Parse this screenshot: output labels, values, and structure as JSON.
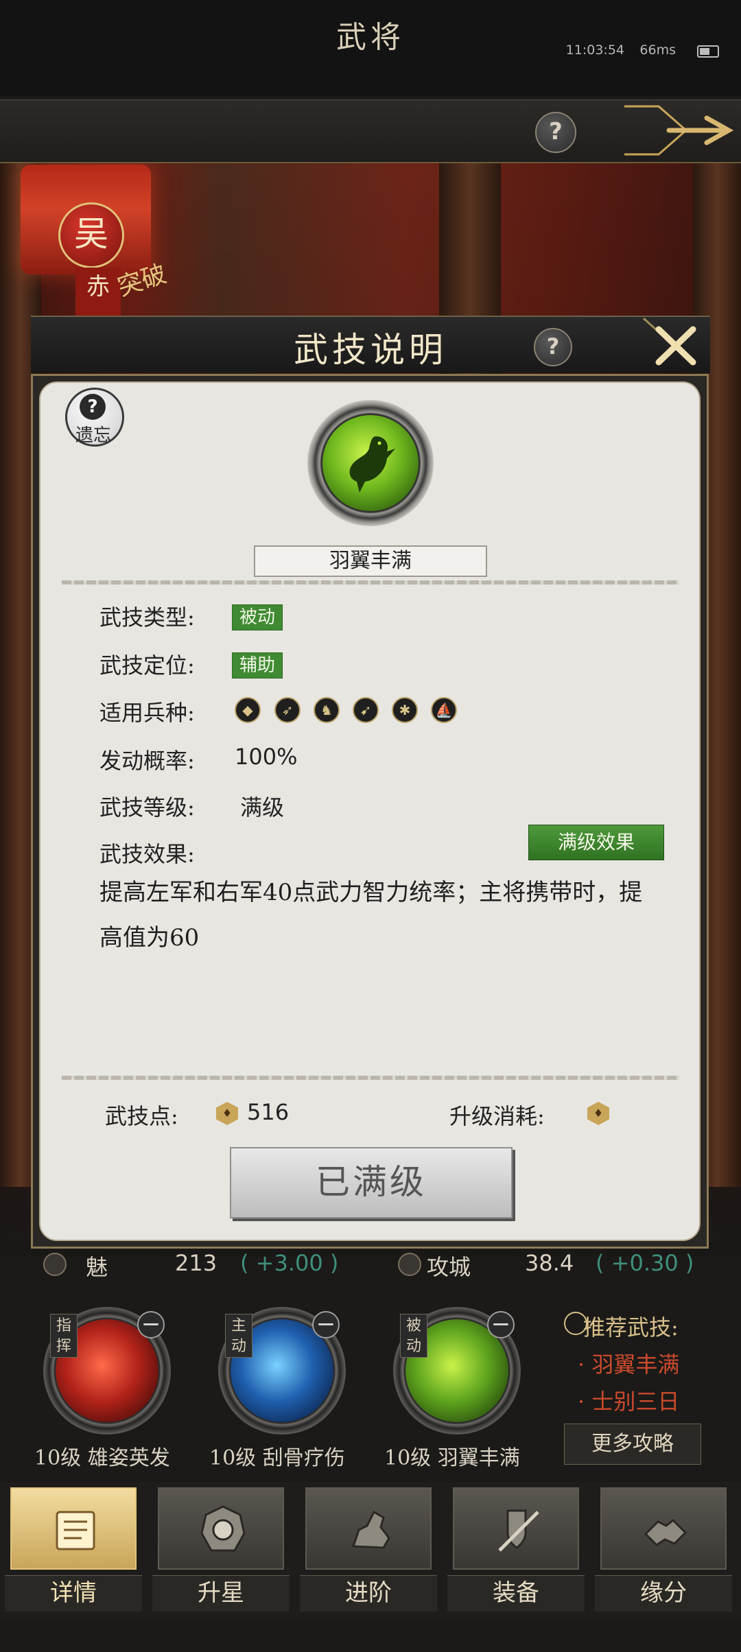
{
  "status_bar": {
    "time": "11:03:54",
    "ping": "66ms"
  },
  "title_bar": {
    "title": "武将"
  },
  "hero": {
    "faction": "吴",
    "tag": "赤",
    "breakthrough": "突破"
  },
  "dialog": {
    "title": "武技说明",
    "forget_label": "遗忘",
    "skill_name": "羽翼丰满",
    "rows": {
      "type_label": "武技类型:",
      "type_value": "被动",
      "role_label": "武技定位:",
      "role_value": "辅助",
      "units_label": "适用兵种:",
      "rate_label": "发动概率:",
      "rate_value": "100%",
      "level_label": "武技等级:",
      "level_value": "满级",
      "effect_label": "武技效果:"
    },
    "max_effect_button": "满级效果",
    "effect_text": "提高左军和右军40点武力智力统率；主将携带时，提高值为60",
    "points_label": "武技点:",
    "points_value": "516",
    "cost_label": "升级消耗:",
    "maxed_button": "已满级",
    "unit_icons": [
      "shield-icon",
      "spear-icon",
      "cavalry-icon",
      "bow-icon",
      "wheel-icon",
      "ship-icon"
    ]
  },
  "stats": {
    "charm_label": "魅",
    "charm_value": "213",
    "charm_bonus": "( +3.00 )",
    "siege_label": "攻城",
    "siege_value": "38.4",
    "siege_bonus": "( +0.30 )"
  },
  "skills": [
    {
      "type": "指挥",
      "caption": "10级 雄姿英发",
      "color": "#b3231a"
    },
    {
      "type": "主动",
      "caption": "10级 刮骨疗伤",
      "color": "#1f5fae"
    },
    {
      "type": "被动",
      "caption": "10级 羽翼丰满",
      "color": "#5fa51e"
    }
  ],
  "recommend": {
    "title": "推荐武技:",
    "items": [
      "· 羽翼丰满",
      "· 士别三日"
    ],
    "more_button": "更多攻略"
  },
  "nav": [
    "详情",
    "升星",
    "进阶",
    "装备",
    "缘分"
  ],
  "colors": {
    "accent_gold": "#e2c37a",
    "green_tag": "#3f8a32",
    "red_text": "#cc4a2d"
  }
}
